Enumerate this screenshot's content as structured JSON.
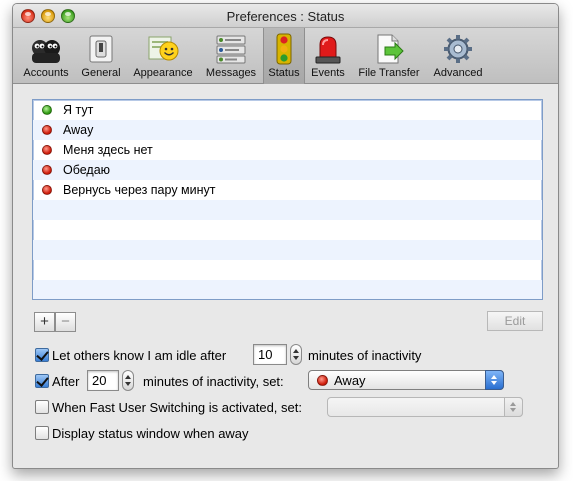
{
  "window": {
    "title": "Preferences : Status"
  },
  "toolbar": {
    "items": [
      {
        "label": "Accounts",
        "icon": "accounts-icon"
      },
      {
        "label": "General",
        "icon": "general-switch-icon"
      },
      {
        "label": "Appearance",
        "icon": "appearance-smiley-icon"
      },
      {
        "label": "Messages",
        "icon": "messages-icon"
      },
      {
        "label": "Status",
        "icon": "traffic-light-icon",
        "selected": true
      },
      {
        "label": "Events",
        "icon": "siren-icon"
      },
      {
        "label": "File Transfer",
        "icon": "file-transfer-icon"
      },
      {
        "label": "Advanced",
        "icon": "gear-icon"
      }
    ]
  },
  "status_list": {
    "items": [
      {
        "label": "Я тут",
        "color": "green"
      },
      {
        "label": "Away",
        "color": "red"
      },
      {
        "label": "Меня здесь нет",
        "color": "red"
      },
      {
        "label": "Обедаю",
        "color": "red"
      },
      {
        "label": "Вернусь через пару минут",
        "color": "red"
      }
    ]
  },
  "buttons": {
    "add": "+",
    "remove": "−",
    "edit": "Edit"
  },
  "options": {
    "idle": {
      "label": "Let others know I am idle after",
      "value": "10",
      "suffix": "minutes of inactivity",
      "checked": true
    },
    "auto_away": {
      "label_prefix": "After",
      "value": "20",
      "label_mid": "minutes of inactivity, set:",
      "selected": "Away",
      "checked": true
    },
    "fast_user": {
      "label": "When Fast User Switching is activated, set:",
      "checked": false
    },
    "display_status": {
      "label": "Display status window when away",
      "checked": false
    }
  },
  "colors": {
    "list_border": "#7e9cc7",
    "stripe": "#edf3fe",
    "away_red": "#cf1c0a",
    "available_green": "#2f9a11"
  }
}
